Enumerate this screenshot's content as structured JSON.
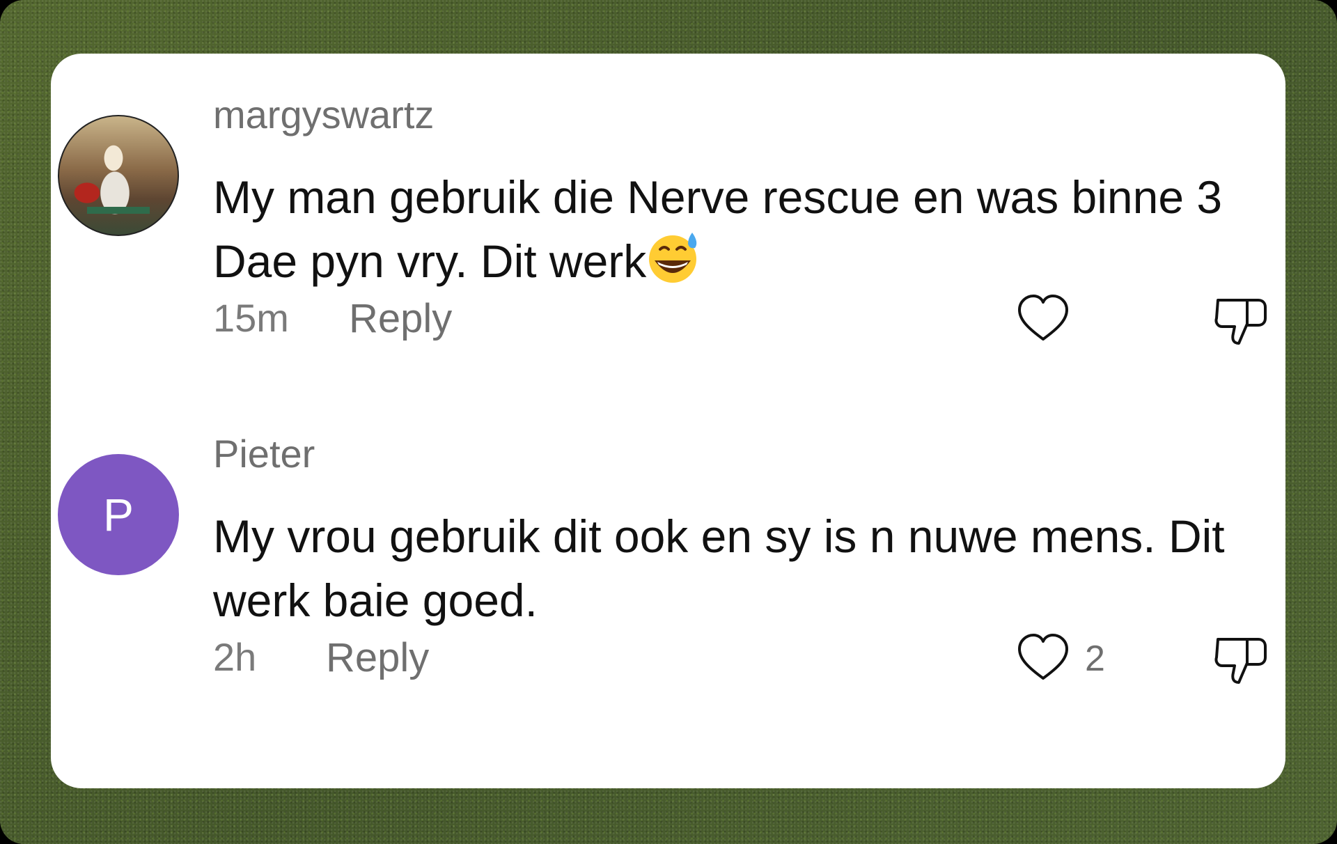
{
  "comments": [
    {
      "username": "margyswartz",
      "avatar": "profile-photo",
      "text": "My man gebruik die Nerve rescue en was binne 3 Dae pyn vry. Dit werk",
      "emoji": "grinning-face-with-sweat-emoji",
      "time": "15m",
      "reply_label": "Reply",
      "likes": ""
    },
    {
      "username": "Pieter",
      "avatar_letter": "P",
      "avatar_color": "#7e57c2",
      "text": "My vrou gebruik dit ook en sy is n nuwe mens. Dit werk baie goed.",
      "time": "2h",
      "reply_label": "Reply",
      "likes": "2"
    }
  ],
  "icons": {
    "like": "heart-outline-icon",
    "dislike": "thumbs-down-outline-icon"
  },
  "colors": {
    "background": "#4a5e2a",
    "card": "#ffffff",
    "avatar_purple": "#7e57c2",
    "secondary_text": "#6f6f6f",
    "primary_text": "#111111"
  }
}
